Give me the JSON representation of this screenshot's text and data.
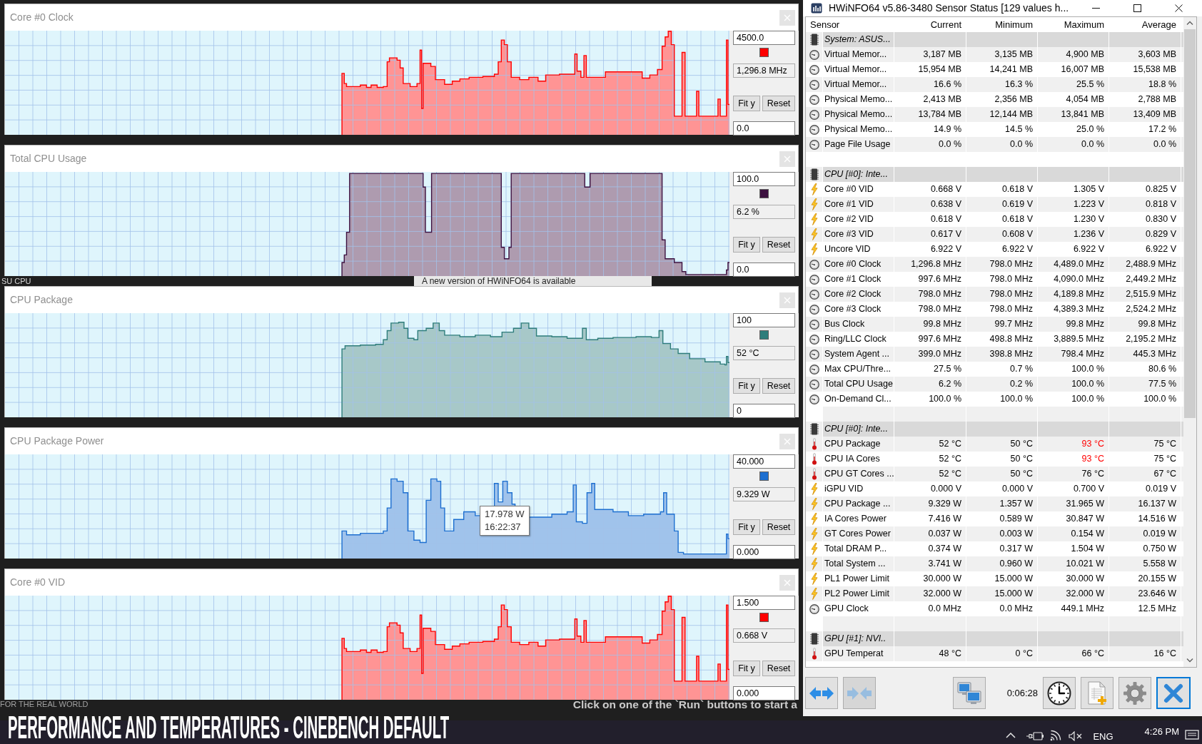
{
  "graph_windows": [
    {
      "title": "Core #0 Clock",
      "y_max": "4500.0",
      "color": "#ff0000",
      "current": "1,296.8 MHz",
      "fit_label": "Fit y",
      "reset_label": "Reset",
      "y_min": "0.0"
    },
    {
      "title": "Total CPU Usage",
      "y_max": "100.0",
      "color": "#3d1140",
      "current": "6.2 %",
      "fit_label": "Fit y",
      "reset_label": "Reset",
      "y_min": "0.0"
    },
    {
      "title": "CPU Package",
      "y_max": "100",
      "color": "#2e7d7b",
      "current": "52 °C",
      "fit_label": "Fit y",
      "reset_label": "Reset",
      "y_min": "0"
    },
    {
      "title": "CPU Package Power",
      "y_max": "40.000",
      "color": "#1d6fd0",
      "current": "9.329 W",
      "fit_label": "Fit y",
      "reset_label": "Reset",
      "y_min": "0.000",
      "tooltip": {
        "value": "17.978 W",
        "time": "16:22:37"
      }
    },
    {
      "title": "Core #0 VID",
      "y_max": "1.500",
      "color": "#ff0000",
      "current": "0.668 V",
      "fit_label": "Fit y",
      "reset_label": "Reset",
      "y_min": "0.000"
    }
  ],
  "desktop": {
    "side_text": "SU CPU",
    "update_notice": "A new version of HWiNFO64 is available",
    "logo_text": "FOR THE REAL WORLD",
    "hint": "Click on one of the `Run` buttons to start a"
  },
  "sensor_window": {
    "title": "HWiNFO64 v5.86-3480 Sensor Status [129 values h...",
    "columns": [
      "Sensor",
      "Current",
      "Minimum",
      "Maximum",
      "Average"
    ],
    "groups": [
      {
        "name": "System: ASUS...",
        "sensors": [
          {
            "kind": "gauge",
            "name": "Virtual Memor...",
            "values": [
              "3,187 MB",
              "3,135 MB",
              "4,900 MB",
              "3,603 MB"
            ],
            "max_alert": false
          },
          {
            "kind": "gauge",
            "name": "Virtual Memor...",
            "values": [
              "15,954 MB",
              "14,241 MB",
              "16,007 MB",
              "15,538 MB"
            ],
            "max_alert": false
          },
          {
            "kind": "gauge",
            "name": "Virtual Memor...",
            "values": [
              "16.6 %",
              "16.3 %",
              "25.5 %",
              "18.8 %"
            ],
            "max_alert": false
          },
          {
            "kind": "gauge",
            "name": "Physical Memo...",
            "values": [
              "2,413 MB",
              "2,356 MB",
              "4,054 MB",
              "2,788 MB"
            ],
            "max_alert": false
          },
          {
            "kind": "gauge",
            "name": "Physical Memo...",
            "values": [
              "13,784 MB",
              "12,144 MB",
              "13,841 MB",
              "13,409 MB"
            ],
            "max_alert": false
          },
          {
            "kind": "gauge",
            "name": "Physical Memo...",
            "values": [
              "14.9 %",
              "14.5 %",
              "25.0 %",
              "17.2 %"
            ],
            "max_alert": false
          },
          {
            "kind": "gauge",
            "name": "Page File Usage",
            "values": [
              "0.0 %",
              "0.0 %",
              "0.0 %",
              "0.0 %"
            ],
            "max_alert": false
          }
        ]
      },
      {
        "name": "CPU [#0]: Inte...",
        "sensors": [
          {
            "kind": "electric",
            "name": "Core #0 VID",
            "values": [
              "0.668 V",
              "0.618 V",
              "1.305 V",
              "0.825 V"
            ],
            "max_alert": false
          },
          {
            "kind": "electric",
            "name": "Core #1 VID",
            "values": [
              "0.638 V",
              "0.619 V",
              "1.223 V",
              "0.818 V"
            ],
            "max_alert": false
          },
          {
            "kind": "electric",
            "name": "Core #2 VID",
            "values": [
              "0.618 V",
              "0.618 V",
              "1.230 V",
              "0.830 V"
            ],
            "max_alert": false
          },
          {
            "kind": "electric",
            "name": "Core #3 VID",
            "values": [
              "0.617 V",
              "0.608 V",
              "1.236 V",
              "0.829 V"
            ],
            "max_alert": false
          },
          {
            "kind": "electric",
            "name": "Uncore VID",
            "values": [
              "6.922 V",
              "6.922 V",
              "6.922 V",
              "6.922 V"
            ],
            "max_alert": false
          },
          {
            "kind": "gauge",
            "name": "Core #0 Clock",
            "values": [
              "1,296.8 MHz",
              "798.0 MHz",
              "4,489.0 MHz",
              "2,488.9 MHz"
            ],
            "max_alert": false
          },
          {
            "kind": "gauge",
            "name": "Core #1 Clock",
            "values": [
              "997.6 MHz",
              "798.0 MHz",
              "4,090.0 MHz",
              "2,449.2 MHz"
            ],
            "max_alert": false
          },
          {
            "kind": "gauge",
            "name": "Core #2 Clock",
            "values": [
              "798.0 MHz",
              "798.0 MHz",
              "4,189.8 MHz",
              "2,515.9 MHz"
            ],
            "max_alert": false
          },
          {
            "kind": "gauge",
            "name": "Core #3 Clock",
            "values": [
              "798.0 MHz",
              "798.0 MHz",
              "4,389.3 MHz",
              "2,524.2 MHz"
            ],
            "max_alert": false
          },
          {
            "kind": "gauge",
            "name": "Bus Clock",
            "values": [
              "99.8 MHz",
              "99.7 MHz",
              "99.8 MHz",
              "99.8 MHz"
            ],
            "max_alert": false
          },
          {
            "kind": "gauge",
            "name": "Ring/LLC Clock",
            "values": [
              "997.6 MHz",
              "498.8 MHz",
              "3,889.5 MHz",
              "2,195.2 MHz"
            ],
            "max_alert": false
          },
          {
            "kind": "gauge",
            "name": "System Agent ...",
            "values": [
              "399.0 MHz",
              "398.8 MHz",
              "798.4 MHz",
              "445.3 MHz"
            ],
            "max_alert": false
          },
          {
            "kind": "gauge",
            "name": "Max CPU/Thre...",
            "values": [
              "27.5 %",
              "0.7 %",
              "100.0 %",
              "80.6 %"
            ],
            "max_alert": false
          },
          {
            "kind": "gauge",
            "name": "Total CPU Usage",
            "values": [
              "6.2 %",
              "0.2 %",
              "100.0 %",
              "77.5 %"
            ],
            "max_alert": false
          },
          {
            "kind": "gauge",
            "name": "On-Demand Cl...",
            "values": [
              "100.0 %",
              "100.0 %",
              "100.0 %",
              "100.0 %"
            ],
            "max_alert": false
          }
        ]
      },
      {
        "name": "CPU [#0]: Inte...",
        "sensors": [
          {
            "kind": "temperature",
            "name": "CPU Package",
            "values": [
              "52 °C",
              "50 °C",
              "93 °C",
              "75 °C"
            ],
            "max_alert": true
          },
          {
            "kind": "temperature",
            "name": "CPU IA Cores",
            "values": [
              "52 °C",
              "50 °C",
              "93 °C",
              "75 °C"
            ],
            "max_alert": true
          },
          {
            "kind": "temperature",
            "name": "CPU GT Cores ...",
            "values": [
              "52 °C",
              "50 °C",
              "76 °C",
              "67 °C"
            ],
            "max_alert": false
          },
          {
            "kind": "electric",
            "name": "iGPU VID",
            "values": [
              "0.000 V",
              "0.000 V",
              "0.700 V",
              "0.019 V"
            ],
            "max_alert": false
          },
          {
            "kind": "electric",
            "name": "CPU Package ...",
            "values": [
              "9.329 W",
              "1.357 W",
              "31.965 W",
              "16.137 W"
            ],
            "max_alert": false
          },
          {
            "kind": "electric",
            "name": "IA Cores Power",
            "values": [
              "7.416 W",
              "0.589 W",
              "30.847 W",
              "14.516 W"
            ],
            "max_alert": false
          },
          {
            "kind": "electric",
            "name": "GT Cores Power",
            "values": [
              "0.037 W",
              "0.003 W",
              "0.154 W",
              "0.019 W"
            ],
            "max_alert": false
          },
          {
            "kind": "electric",
            "name": "Total DRAM P...",
            "values": [
              "0.374 W",
              "0.317 W",
              "1.504 W",
              "0.750 W"
            ],
            "max_alert": false
          },
          {
            "kind": "electric",
            "name": "Total System ...",
            "values": [
              "3.741 W",
              "0.960 W",
              "10.021 W",
              "5.558 W"
            ],
            "max_alert": false
          },
          {
            "kind": "electric",
            "name": "PL1 Power Limit",
            "values": [
              "30.000 W",
              "15.000 W",
              "30.000 W",
              "20.155 W"
            ],
            "max_alert": false
          },
          {
            "kind": "electric",
            "name": "PL2 Power Limit",
            "values": [
              "32.000 W",
              "15.000 W",
              "32.000 W",
              "23.646 W"
            ],
            "max_alert": false
          },
          {
            "kind": "gauge",
            "name": "GPU Clock",
            "values": [
              "0.0 MHz",
              "0.0 MHz",
              "449.1 MHz",
              "12.5 MHz"
            ],
            "max_alert": false
          }
        ]
      },
      {
        "name": "GPU [#1]: NVI..",
        "sensors": [
          {
            "kind": "temperature",
            "name": "GPU Temperat",
            "values": [
              "48 °C",
              "0 °C",
              "66 °C",
              "16 °C"
            ],
            "max_alert": false
          }
        ]
      }
    ],
    "toolbar": [
      {
        "kind": "expand",
        "disabled": false,
        "focused": false
      },
      {
        "kind": "collapse",
        "disabled": true,
        "focused": false
      },
      {
        "kind": "network",
        "disabled": false,
        "focused": false
      },
      {
        "kind": "timer",
        "disabled": false,
        "focused": false
      },
      {
        "kind": "log",
        "disabled": false,
        "focused": false
      },
      {
        "kind": "settings",
        "disabled": false,
        "focused": false
      },
      {
        "kind": "close",
        "disabled": false,
        "focused": true
      }
    ],
    "elapsed": "0:06:28"
  },
  "caption": "PERFORMANCE AND TEMPERATURES - CINEBENCH DEFAULT",
  "taskbar": {
    "language": "ENG",
    "time": "4:26 PM"
  }
}
